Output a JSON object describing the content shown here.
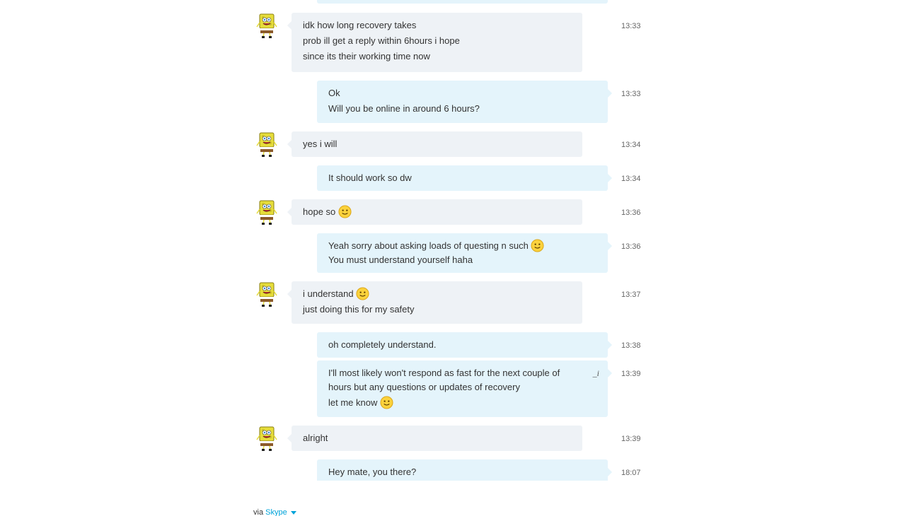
{
  "colors": {
    "incoming_bubble": "#eef2f6",
    "outgoing_bubble": "#e4f4fb",
    "link": "#00a3d9"
  },
  "messages": [
    {
      "from": "them",
      "time": "13:33",
      "lines": [
        "idk how long recovery takes",
        "prob ill get a reply within 6hours i hope",
        "since its their working time now"
      ]
    },
    {
      "from": "me",
      "time": "13:33",
      "lines": [
        "Ok",
        "Will you be online in around 6 hours?"
      ]
    },
    {
      "from": "them",
      "time": "13:34",
      "lines": [
        "yes i will"
      ]
    },
    {
      "from": "me",
      "time": "13:34",
      "lines": [
        "It should work so dw"
      ]
    },
    {
      "from": "them",
      "time": "13:36",
      "lines": [
        "hope so"
      ]
    },
    {
      "from": "me",
      "time": "13:36",
      "lines": [
        "Yeah sorry about asking loads of questing n such",
        "You must understand yourself haha"
      ]
    },
    {
      "from": "them",
      "time": "13:37",
      "lines": [
        "i understand",
        "just doing this for my safety"
      ]
    },
    {
      "from": "me",
      "time": "13:38",
      "lines": [
        "oh completely understand."
      ]
    },
    {
      "from": "me",
      "time": "13:39",
      "lines": [
        "I'll most likely won't respond as fast for the next couple of hours but any questions or updates of recovery",
        "let me know"
      ],
      "edited": true
    },
    {
      "from": "them",
      "time": "13:39",
      "lines": [
        "alright"
      ]
    },
    {
      "from": "me",
      "time": "18:07",
      "lines": [
        "Hey mate, you there?"
      ]
    }
  ],
  "footer": {
    "via": "via",
    "brand": "Skype"
  }
}
